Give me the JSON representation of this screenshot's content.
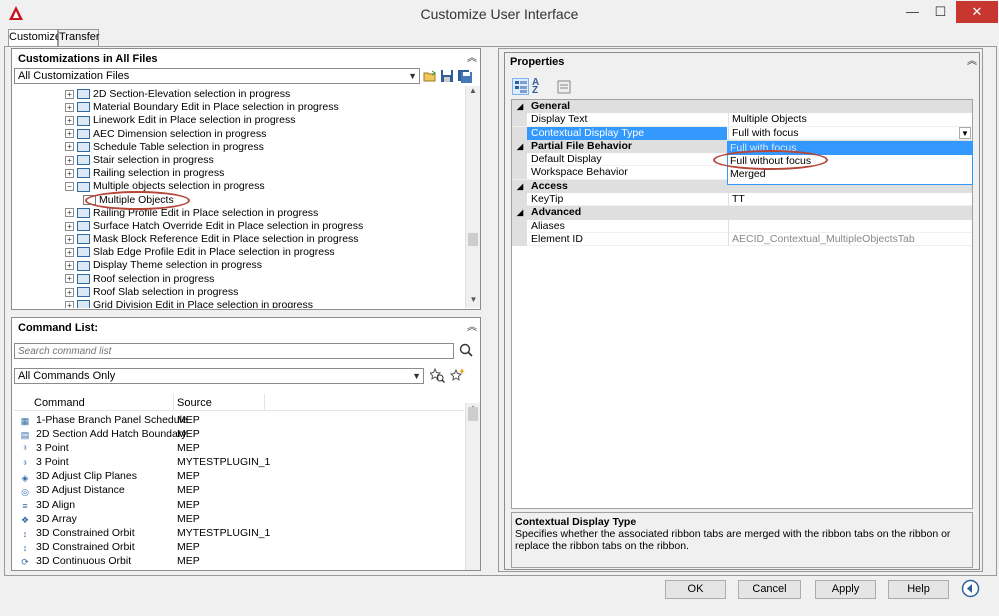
{
  "window": {
    "title": "Customize User Interface",
    "minimize": "—",
    "maximize": "☐",
    "close": "✕"
  },
  "tabs": [
    "Customize",
    "Transfer"
  ],
  "customizations": {
    "header": "Customizations in All Files",
    "file_select": "All Customization Files",
    "tree": [
      {
        "label": "2D Section-Elevation selection in progress",
        "expander": "+"
      },
      {
        "label": "Material Boundary Edit in Place selection in progress",
        "expander": "+"
      },
      {
        "label": "Linework Edit in Place selection in progress",
        "expander": "+"
      },
      {
        "label": "AEC Dimension selection in progress",
        "expander": "+"
      },
      {
        "label": "Schedule Table selection in progress",
        "expander": "+"
      },
      {
        "label": "Stair selection in progress",
        "expander": "+"
      },
      {
        "label": "Railing selection in progress",
        "expander": "+"
      },
      {
        "label": "Multiple objects selection in progress",
        "expander": "−"
      },
      {
        "label": "Multiple Objects",
        "expander": ""
      },
      {
        "label": "Railing Profile Edit in Place selection in progress",
        "expander": "+"
      },
      {
        "label": "Surface Hatch Override Edit in Place selection in progress",
        "expander": "+"
      },
      {
        "label": "Mask Block Reference Edit in Place selection in progress",
        "expander": "+"
      },
      {
        "label": "Slab Edge Profile Edit in Place selection in progress",
        "expander": "+"
      },
      {
        "label": "Display Theme selection in progress",
        "expander": "+"
      },
      {
        "label": "Roof selection in progress",
        "expander": "+"
      },
      {
        "label": "Roof Slab selection in progress",
        "expander": "+"
      },
      {
        "label": "Grid Division Edit in Place selection in progress",
        "expander": "+"
      }
    ]
  },
  "command_list": {
    "header": "Command List:",
    "search_placeholder": "Search command list",
    "filter": "All Commands Only",
    "columns": [
      "Command",
      "Source"
    ],
    "rows": [
      {
        "command": "1-Phase Branch Panel Schedule",
        "source": "MEP"
      },
      {
        "command": "2D Section Add Hatch Boundary",
        "source": "MEP"
      },
      {
        "command": "3 Point",
        "source": "MEP"
      },
      {
        "command": "3 Point",
        "source": "MYTESTPLUGIN_1"
      },
      {
        "command": "3D Adjust Clip Planes",
        "source": "MEP"
      },
      {
        "command": "3D Adjust Distance",
        "source": "MEP"
      },
      {
        "command": "3D Align",
        "source": "MEP"
      },
      {
        "command": "3D Array",
        "source": "MEP"
      },
      {
        "command": "3D Constrained Orbit",
        "source": "MYTESTPLUGIN_1"
      },
      {
        "command": "3D Constrained Orbit",
        "source": "MEP"
      },
      {
        "command": "3D Continuous Orbit",
        "source": "MEP"
      }
    ]
  },
  "properties": {
    "header": "Properties",
    "rows": [
      {
        "type": "cat",
        "name": "General"
      },
      {
        "type": "prop",
        "name": "Display Text",
        "value": "Multiple Objects"
      },
      {
        "type": "prop",
        "name": "Contextual Display Type",
        "value": "Full with focus",
        "selected": true
      },
      {
        "type": "cat",
        "name": "Partial File Behavior"
      },
      {
        "type": "prop",
        "name": "Default Display",
        "value": ""
      },
      {
        "type": "prop",
        "name": "Workspace Behavior",
        "value": ""
      },
      {
        "type": "cat",
        "name": "Access"
      },
      {
        "type": "prop",
        "name": "KeyTip",
        "value": "TT"
      },
      {
        "type": "cat",
        "name": "Advanced"
      },
      {
        "type": "prop",
        "name": "Aliases",
        "value": ""
      },
      {
        "type": "prop",
        "name": "Element ID",
        "value": "AECID_Contextual_MultipleObjectsTab",
        "grey": true
      }
    ],
    "dropdown_options": [
      "Full with focus",
      "Full without focus",
      "Merged"
    ],
    "help_title": "Contextual Display Type",
    "help_text": "Specifies whether the associated ribbon tabs are merged with the ribbon tabs on the ribbon or replace the ribbon tabs on the ribbon."
  },
  "buttons": {
    "ok": "OK",
    "cancel": "Cancel",
    "apply": "Apply",
    "help": "Help"
  },
  "colors": {
    "accent": "#3399ff",
    "highlight_oval": "#b5473a",
    "selected_row": "#3399ff"
  }
}
